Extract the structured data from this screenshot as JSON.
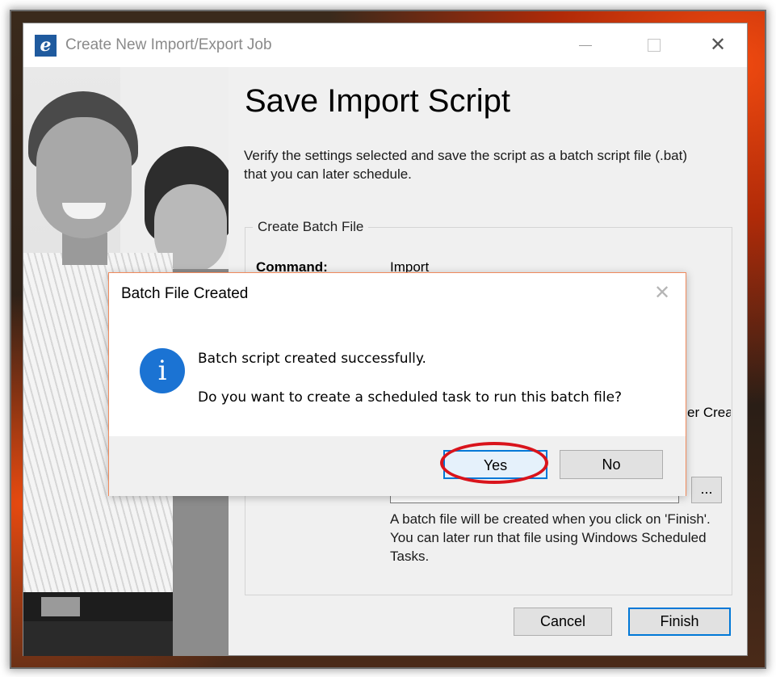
{
  "window": {
    "title": "Create New Import/Export Job",
    "app_icon": "e"
  },
  "page": {
    "heading": "Save Import Script",
    "description": "Verify the settings selected and save the script as a batch script file (.bat) that you can later schedule."
  },
  "group": {
    "legend": "Create Batch File",
    "command_label": "Command:",
    "command_value": "Import",
    "partial_text": "er Creat",
    "browse_label": "...",
    "note": "A batch file will be created when you click on 'Finish'. You can later run that file using Windows Scheduled Tasks."
  },
  "buttons": {
    "cancel": "Cancel",
    "finish": "Finish"
  },
  "dialog": {
    "title": "Batch File Created",
    "icon": "info-icon",
    "icon_glyph": "i",
    "message_line1": "Batch script created successfully.",
    "message_line2": "Do you want to create a scheduled task to run this batch file?",
    "yes": "Yes",
    "no": "No"
  },
  "colors": {
    "accent": "#0078d7",
    "info_icon": "#1b73d3",
    "highlight": "#d9141c"
  }
}
